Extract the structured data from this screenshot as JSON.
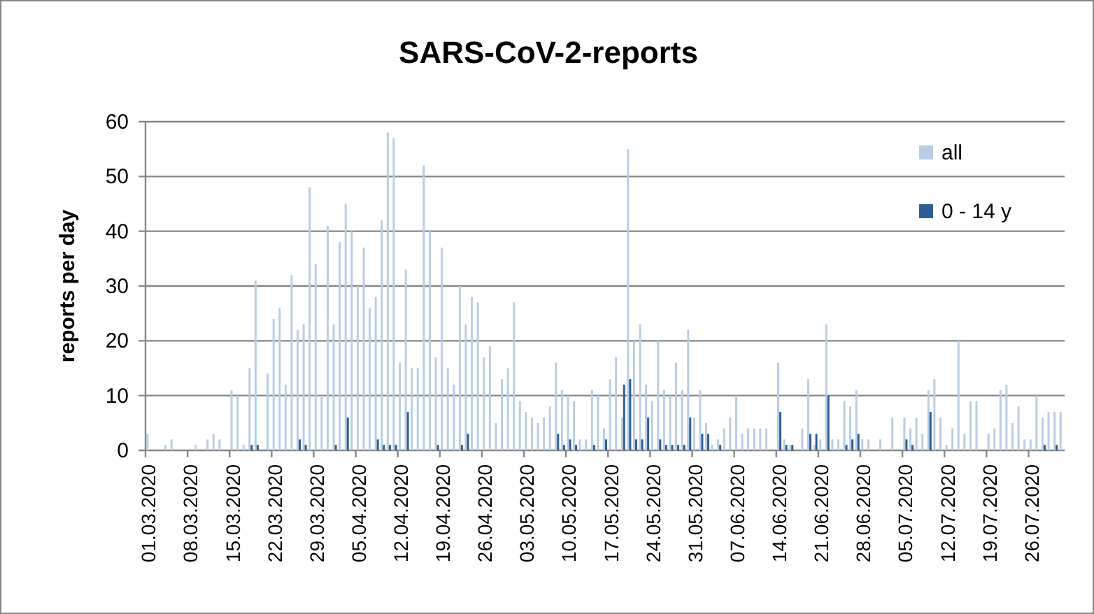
{
  "chart": {
    "chart_data": {
      "type": "bar",
      "title": "SARS-CoV-2-reports",
      "ylabel": "reports per day",
      "ylim": [
        0,
        60
      ],
      "yticks": [
        0,
        10,
        20,
        30,
        40,
        50,
        60
      ],
      "grid": true,
      "legend": true,
      "categories": [
        "01.03.2020",
        null,
        null,
        null,
        null,
        null,
        null,
        "08.03.2020",
        null,
        null,
        null,
        null,
        null,
        null,
        "15.03.2020",
        null,
        null,
        null,
        null,
        null,
        null,
        "22.03.2020",
        null,
        null,
        null,
        null,
        null,
        null,
        "29.03.2020",
        null,
        null,
        null,
        null,
        null,
        null,
        "05.04.2020",
        null,
        null,
        null,
        null,
        null,
        null,
        "12.04.2020",
        null,
        null,
        null,
        null,
        null,
        null,
        "19.04.2020",
        null,
        null,
        null,
        null,
        null,
        null,
        "26.04.2020",
        null,
        null,
        null,
        null,
        null,
        null,
        "03.05.2020",
        null,
        null,
        null,
        null,
        null,
        null,
        "10.05.2020",
        null,
        null,
        null,
        null,
        null,
        null,
        "17.05.2020",
        null,
        null,
        null,
        null,
        null,
        null,
        "24.05.2020",
        null,
        null,
        null,
        null,
        null,
        null,
        "31.05.2020",
        null,
        null,
        null,
        null,
        null,
        null,
        "07.06.2020",
        null,
        null,
        null,
        null,
        null,
        null,
        "14.06.2020",
        null,
        null,
        null,
        null,
        null,
        null,
        "21.06.2020",
        null,
        null,
        null,
        null,
        null,
        null,
        "28.06.2020",
        null,
        null,
        null,
        null,
        null,
        null,
        "05.07.2020",
        null,
        null,
        null,
        null,
        null,
        null,
        "12.07.2020",
        null,
        null,
        null,
        null,
        null,
        null,
        "19.07.2020",
        null,
        null,
        null,
        null,
        null,
        null,
        "26.07.2020",
        null,
        null,
        null,
        null,
        null
      ],
      "series": [
        {
          "name": "all",
          "color": "#b9cde5",
          "values": [
            3,
            0,
            0,
            1,
            2,
            0,
            0,
            0,
            1,
            0,
            2,
            3,
            2,
            0,
            11,
            10,
            1,
            15,
            31,
            0,
            14,
            24,
            26,
            12,
            32,
            22,
            23,
            48,
            34,
            10,
            41,
            23,
            38,
            45,
            40,
            30,
            37,
            26,
            28,
            42,
            58,
            57,
            16,
            33,
            15,
            15,
            52,
            40,
            17,
            37,
            15,
            12,
            30,
            23,
            28,
            27,
            17,
            19,
            5,
            13,
            15,
            27,
            9,
            7,
            6,
            5,
            6,
            8,
            16,
            11,
            10,
            9,
            2,
            2,
            11,
            10,
            4,
            13,
            17,
            6,
            55,
            20,
            23,
            12,
            9,
            20,
            11,
            10,
            16,
            11,
            22,
            6,
            11,
            5,
            1,
            2,
            4,
            6,
            10,
            3,
            4,
            4,
            4,
            4,
            0,
            16,
            2,
            1,
            0,
            4,
            13,
            1,
            2,
            23,
            2,
            2,
            9,
            8,
            11,
            2,
            2,
            0,
            2,
            0,
            6,
            0,
            6,
            4,
            6,
            3,
            11,
            13,
            6,
            1,
            4,
            20,
            3,
            9,
            9,
            0,
            3,
            4,
            11,
            12,
            5,
            8,
            2,
            2,
            10,
            6,
            7,
            7,
            7
          ]
        },
        {
          "name": "0 - 14 y",
          "color": "#2e5d94",
          "values": [
            0,
            0,
            0,
            0,
            0,
            0,
            0,
            0,
            0,
            0,
            0,
            0,
            0,
            0,
            0,
            0,
            0,
            1,
            1,
            0,
            0,
            0,
            0,
            0,
            0,
            2,
            1,
            0,
            0,
            0,
            0,
            1,
            0,
            6,
            0,
            0,
            0,
            0,
            2,
            1,
            1,
            1,
            0,
            7,
            0,
            0,
            0,
            0,
            1,
            0,
            0,
            0,
            1,
            3,
            0,
            0,
            0,
            0,
            0,
            0,
            0,
            0,
            0,
            0,
            0,
            0,
            0,
            0,
            3,
            1,
            2,
            1,
            0,
            0,
            1,
            0,
            2,
            0,
            0,
            12,
            13,
            2,
            2,
            6,
            0,
            2,
            1,
            1,
            1,
            1,
            6,
            0,
            3,
            3,
            0,
            1,
            0,
            0,
            0,
            0,
            0,
            0,
            0,
            0,
            0,
            7,
            1,
            1,
            0,
            0,
            3,
            3,
            0,
            10,
            0,
            0,
            1,
            2,
            3,
            0,
            0,
            0,
            0,
            0,
            0,
            0,
            2,
            1,
            0,
            0,
            7,
            0,
            0,
            0,
            0,
            0,
            0,
            0,
            0,
            0,
            0,
            0,
            0,
            0,
            0,
            0,
            0,
            0,
            0,
            1,
            0,
            1,
            0
          ]
        }
      ]
    }
  }
}
